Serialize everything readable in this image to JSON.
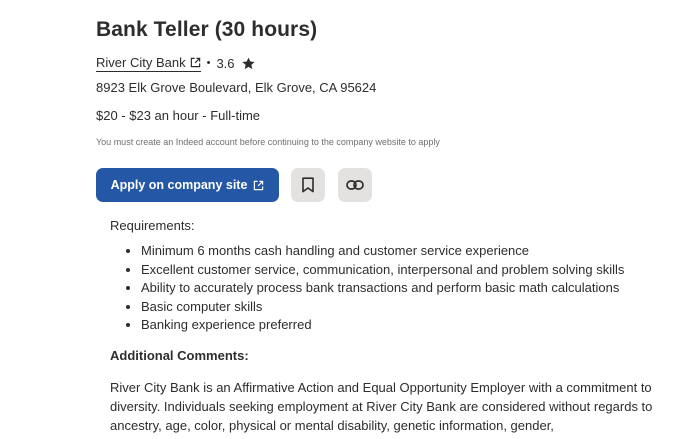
{
  "job": {
    "title": "Bank Teller (30 hours)",
    "company": "River City Bank",
    "rating": "3.6",
    "address": "8923 Elk Grove Boulevard, Elk Grove, CA 95624",
    "salary": "$20 - $23 an hour  - Full-time",
    "notice": "You must create an Indeed account before continuing to the company website to apply"
  },
  "actions": {
    "apply_label": "Apply on company site",
    "save_icon": "bookmark-icon",
    "copy_icon": "link-icon"
  },
  "description": {
    "requirements_label": "Requirements:",
    "requirements": [
      "Minimum 6 months cash handling and customer service experience",
      "Excellent customer service, communication, interpersonal and problem solving skills",
      "Ability to accurately process bank transactions and perform basic math calculations",
      "Basic computer skills",
      "Banking experience preferred"
    ],
    "additional_heading": "Additional Comments:",
    "paragraph": "River City Bank is an Affirmative Action and Equal Opportunity Employer with a commitment to diversity. Individuals seeking employment at River City Bank are considered without regards to ancestry, age, color, physical or mental disability, genetic information, gender,"
  },
  "colors": {
    "primary": "#2557a7",
    "icon_button_bg": "#e4e2e0",
    "text": "#2d2d2d"
  }
}
